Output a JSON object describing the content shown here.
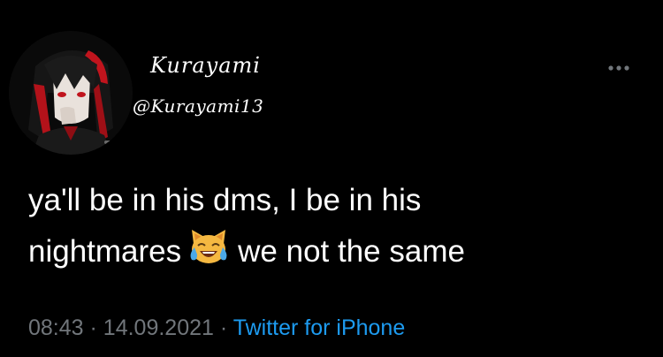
{
  "author": {
    "display_name": "Kurayami",
    "handle": "@Kurayami13"
  },
  "tweet": {
    "text_before_emoji": "ya'll be in his dms, I be in his nightmares",
    "emoji": "cat-with-tears-of-joy",
    "text_after_emoji": "we not the same"
  },
  "meta": {
    "time": "08:43",
    "separator": "·",
    "date": "14.09.2021",
    "source": "Twitter for iPhone"
  },
  "colors": {
    "background": "#000000",
    "text": "#ffffff",
    "muted": "#71767b",
    "link": "#1d9bf0"
  }
}
